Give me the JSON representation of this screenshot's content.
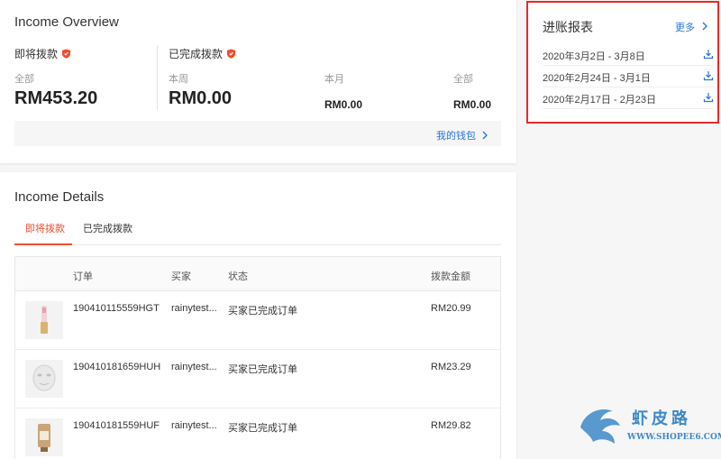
{
  "overview": {
    "title": "Income Overview",
    "pending_label": "即将拨款",
    "completed_label": "已完成拨款",
    "pending_total_label": "全部",
    "pending_total": "RM453.20",
    "week_label": "本周",
    "week_amount": "RM0.00",
    "month_label": "本月",
    "month_amount": "RM0.00",
    "completed_total_label": "全部",
    "completed_total": "RM0.00",
    "wallet_link": "我的钱包"
  },
  "details": {
    "title": "Income Details",
    "tabs": [
      {
        "label": "即将拨款",
        "active": true
      },
      {
        "label": "已完成拨款",
        "active": false
      }
    ],
    "columns": {
      "order": "订单",
      "buyer": "买家",
      "status": "状态",
      "amount": "拨款金额"
    },
    "rows": [
      {
        "order": "190410115559HGT",
        "buyer": "rainytest...",
        "status": "买家已完成订单",
        "amount": "RM20.99",
        "thumb": "lipstick-product-icon"
      },
      {
        "order": "190410181659HUH",
        "buyer": "rainytest...",
        "status": "买家已完成订单",
        "amount": "RM23.29",
        "thumb": "face-mask-product-icon"
      },
      {
        "order": "190410181559HUF",
        "buyer": "rainytest...",
        "status": "买家已完成订单",
        "amount": "RM29.82",
        "thumb": "cream-tube-product-icon"
      }
    ]
  },
  "report": {
    "title": "进账报表",
    "more_label": "更多",
    "items": [
      {
        "label": "2020年3月2日 - 3月8日"
      },
      {
        "label": "2020年2月24日 - 3月1日"
      },
      {
        "label": "2020年2月17日 - 2月23日"
      }
    ]
  },
  "watermark": {
    "title": "虾皮路",
    "url": "WWW.SHOPEE6.COM"
  },
  "colors": {
    "accent": "#ee4d2d",
    "link": "#2673dd",
    "highlight_border": "#e52a2a",
    "background": "#f6f6f6"
  }
}
